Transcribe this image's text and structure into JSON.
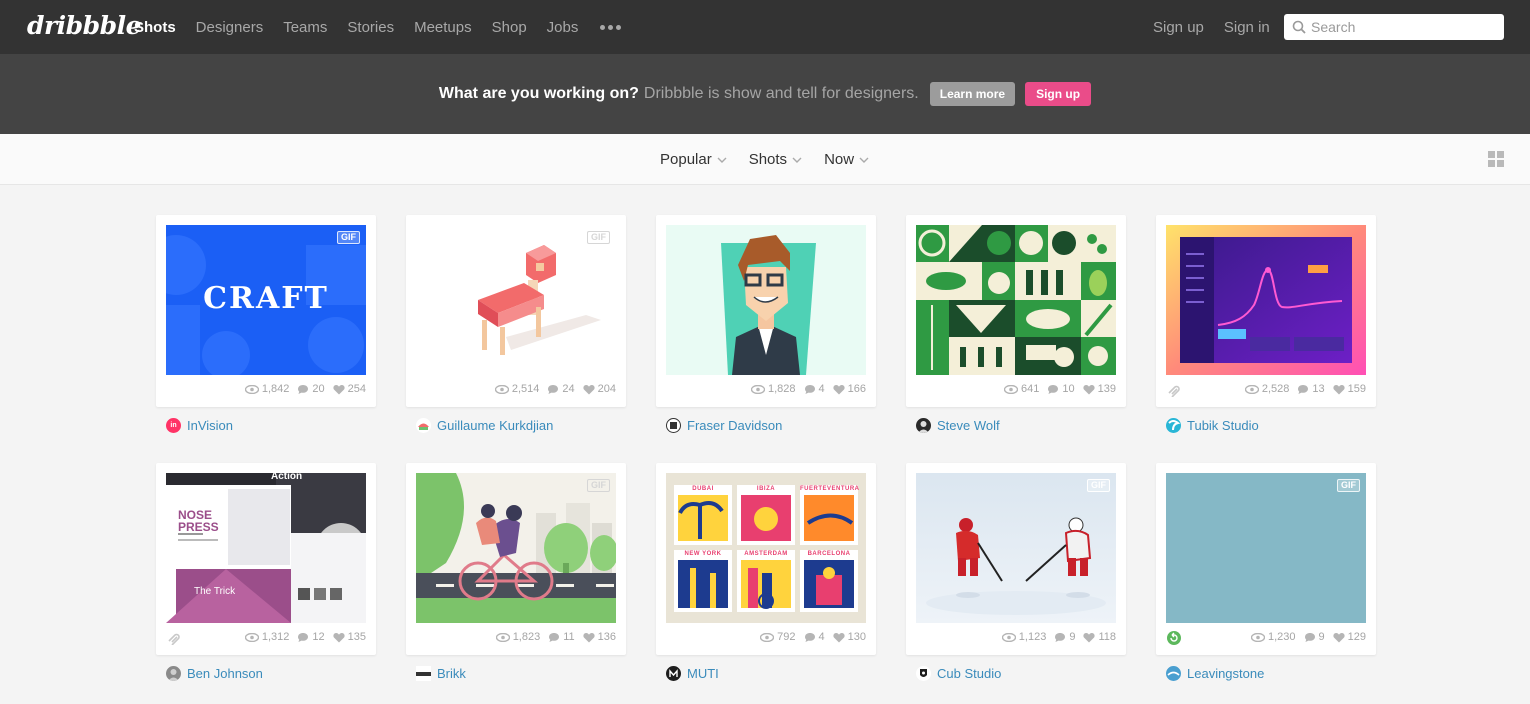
{
  "app": {
    "logo_text": "dribbble"
  },
  "nav": {
    "items": [
      {
        "label": "Shots",
        "active": true
      },
      {
        "label": "Designers",
        "active": false
      },
      {
        "label": "Teams",
        "active": false
      },
      {
        "label": "Stories",
        "active": false
      },
      {
        "label": "Meetups",
        "active": false
      },
      {
        "label": "Shop",
        "active": false
      },
      {
        "label": "Jobs",
        "active": false
      }
    ],
    "more_icon": "ellipsis-icon",
    "sign_up": "Sign up",
    "sign_in": "Sign in",
    "search_placeholder": "Search"
  },
  "banner": {
    "lead": "What are you working on?",
    "sub": "Dribbble is show and tell for designers.",
    "learn_more": "Learn more",
    "sign_up": "Sign up"
  },
  "filters": {
    "popular": "Popular",
    "shots": "Shots",
    "now": "Now"
  },
  "colors": {
    "nav_bg": "#333333",
    "banner_bg": "#444444",
    "accent_pink": "#ea4c89",
    "link_blue": "#3a8bbb"
  },
  "shots": [
    {
      "author": "InVision",
      "views": "1,842",
      "comments": "20",
      "likes": "254",
      "gif": true,
      "gif_label": "GIF",
      "attachment": false,
      "art_text": "CRAFT"
    },
    {
      "author": "Guillaume Kurkdjian",
      "views": "2,514",
      "comments": "24",
      "likes": "204",
      "gif": true,
      "gif_label": "GIF",
      "attachment": false
    },
    {
      "author": "Fraser Davidson",
      "views": "1,828",
      "comments": "4",
      "likes": "166",
      "gif": false,
      "attachment": false
    },
    {
      "author": "Steve Wolf",
      "views": "641",
      "comments": "10",
      "likes": "139",
      "gif": false,
      "attachment": false
    },
    {
      "author": "Tubik Studio",
      "views": "2,528",
      "comments": "13",
      "likes": "159",
      "gif": false,
      "attachment": true
    },
    {
      "author": "Ben Johnson",
      "views": "1,312",
      "comments": "12",
      "likes": "135",
      "gif": false,
      "attachment": true,
      "art_text": "NOSE PRESS",
      "art_text2": "The Trick",
      "art_text3": "Action"
    },
    {
      "author": "Brikk",
      "views": "1,823",
      "comments": "11",
      "likes": "136",
      "gif": true,
      "gif_label": "GIF",
      "attachment": false
    },
    {
      "author": "MUTI",
      "views": "792",
      "comments": "4",
      "likes": "130",
      "gif": false,
      "attachment": false,
      "stamps": [
        "DUBAI",
        "IBIZA",
        "FUERTEVENTURA",
        "NEW YORK",
        "AMSTERDAM",
        "BARCELONA"
      ]
    },
    {
      "author": "Cub Studio",
      "views": "1,123",
      "comments": "9",
      "likes": "118",
      "gif": true,
      "gif_label": "GIF",
      "attachment": false
    },
    {
      "author": "Leavingstone",
      "views": "1,230",
      "comments": "9",
      "likes": "129",
      "gif": true,
      "gif_label": "GIF",
      "attachment": false
    }
  ]
}
